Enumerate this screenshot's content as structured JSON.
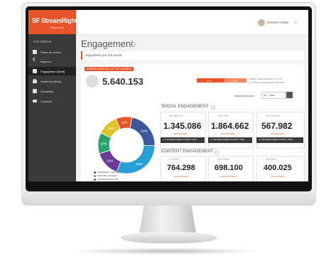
{
  "app": {
    "logo": "SF StreamRights",
    "logo_sub": "Powered by"
  },
  "sidebar": {
    "section": "TUS OBRAS",
    "items": [
      {
        "label": "Panel de control",
        "icon": "dashboard-icon"
      },
      {
        "label": "Ingresos",
        "icon": "euro-icon"
      },
      {
        "label": "Engagement (beta)",
        "icon": "thumbs-up-icon",
        "active": true
      },
      {
        "label": "Audiencia (beta)",
        "icon": "headphones-icon"
      },
      {
        "label": "Fiscalidad",
        "icon": "tax-icon"
      },
      {
        "label": "Contacto",
        "icon": "mail-icon"
      }
    ]
  },
  "user": {
    "name": "Nombre Artista"
  },
  "page": {
    "title": "Engagement",
    "subtitle": "Seguidores por red social"
  },
  "summary": {
    "badge": "NÚMERO AGREGADO DE SEGUIDORES",
    "total": "5.640.153",
    "bar_left": "67%",
    "bar_right": "33%",
    "bar_legend_1": "SOCIAL SEGUIDORES  3.777.716",
    "bar_legend_2": "CONTENT SEGUIDORES  1.862.435"
  },
  "period": {
    "label": "Mostrar evolución:",
    "value": "Ult. 7 días"
  },
  "chart_data": {
    "type": "pie",
    "categories": [
      "Facebook",
      "Twitter",
      "Instagram",
      "Spotify",
      "YouTube",
      "Deezer"
    ],
    "values": [
      24,
      33,
      16,
      13,
      13,
      10
    ],
    "colors": [
      "#3b5998",
      "#2a9fd6",
      "#6a3b99",
      "#2aa36b",
      "#e0c12a",
      "#e8542a"
    ],
    "labels": [
      "24%",
      "33%",
      "16%",
      "13%",
      "13%",
      "10%"
    ]
  },
  "legend": [
    {
      "text": "FACEBOOK  1.345.086",
      "color": "#3b5998"
    },
    {
      "text": "TWITTER  1.864.662",
      "color": "#2a9fd6"
    },
    {
      "text": "INSTAGRAM  567.982",
      "color": "#6a3b99"
    }
  ],
  "social": {
    "title": "SOCIAL ENGAGEMENT",
    "cards": [
      {
        "network": "FACEBOOK",
        "value": "1.345.086",
        "sub": "SEGUIDORES",
        "bar": "▲ 2.1% SEGUIDORES ÚLTIMOS 7 DÍAS"
      },
      {
        "network": "TWITTER",
        "value": "1.864.662",
        "sub": "SEGUIDORES",
        "bar": "▲ 1.8% SEGUIDORES ÚLTIMOS 7 DÍAS"
      },
      {
        "network": "INSTAGRAM",
        "value": "567.982",
        "sub": "SEGUIDORES",
        "bar": "▲ 3.4% SEGUIDORES ÚLTIMOS 7 DÍAS"
      }
    ]
  },
  "content": {
    "title": "CONTENT ENGAGEMENT",
    "cards": [
      {
        "network": "SPOTIFY",
        "value": "764.298",
        "sub": "SEGUIDORES"
      },
      {
        "network": "YOUTUBE",
        "value": "698.100",
        "sub": "SUSCRIPTORES"
      },
      {
        "network": "DEEZER",
        "value": "400.025",
        "sub": "SEGUIDORES"
      }
    ]
  }
}
